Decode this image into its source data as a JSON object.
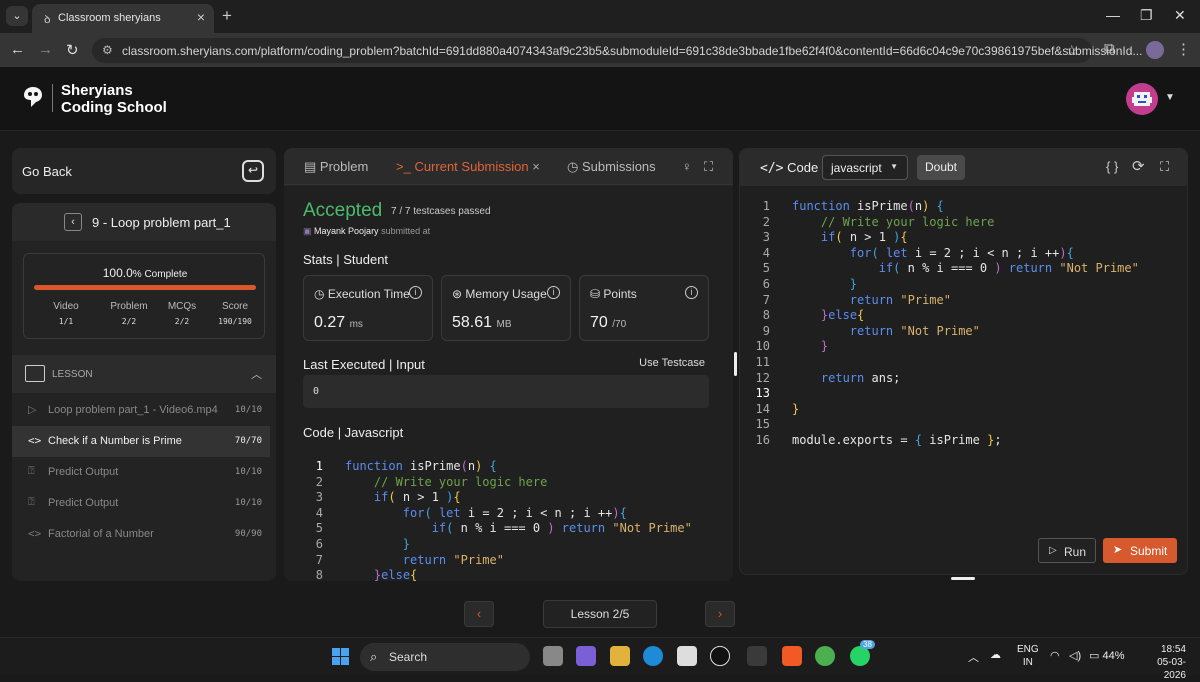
{
  "browser": {
    "tab_title": "Classroom sheryians",
    "url": "classroom.sheryians.com/platform/coding_problem?batchId=691dd880a4074343af9c23b5&submoduleId=691c38de3bbade1fbe62f4f0&contentId=66d6c04c9e70c39861975bef&submissionId..."
  },
  "brand": {
    "line1": "Sheryians",
    "line2": "Coding School"
  },
  "left": {
    "go_back": "Go Back",
    "module_title": "9 - Loop problem part_1",
    "progress": {
      "percent_value": "100.0",
      "percent_suffix": "% Complete",
      "fraction": 1.0,
      "stats": [
        {
          "label": "Video",
          "value": "1/1"
        },
        {
          "label": "Problem",
          "value": "2/2"
        },
        {
          "label": "MCQs",
          "value": "2/2"
        },
        {
          "label": "Score",
          "value": "190/190"
        }
      ]
    },
    "lesson_header": "LESSON",
    "lessons": [
      {
        "icon": "play-icon",
        "label": "Loop problem part_1 - Video6.mp4",
        "score": "10/10"
      },
      {
        "icon": "code-icon",
        "label": "Check if a Number is Prime",
        "score": "70/70"
      },
      {
        "icon": "question-icon",
        "label": "Predict Output",
        "score": "10/10"
      },
      {
        "icon": "question-icon",
        "label": "Predict Output",
        "score": "10/10"
      },
      {
        "icon": "code-icon",
        "label": "Factorial of a Number",
        "score": "90/90"
      }
    ]
  },
  "middle": {
    "tabs": {
      "problem": "Problem",
      "current": "Current Submission",
      "submissions": "Submissions"
    },
    "status": "Accepted",
    "testcases": "7 / 7 testcases passed",
    "submitter": "Mayank Poojary",
    "submitted_at": "submitted at",
    "stats_title": "Stats | Student",
    "stats": {
      "exec_label": "Execution Time",
      "exec_value": "0.27",
      "exec_unit": "ms",
      "mem_label": "Memory Usage",
      "mem_value": "58.61",
      "mem_unit": "MB",
      "points_label": "Points",
      "points_value": "70",
      "points_unit": "/70"
    },
    "last_executed_title": "Last Executed | Input",
    "use_testcase": "Use Testcase",
    "input_value": "0",
    "code_title": "Code | Javascript"
  },
  "editor": {
    "label": "Code",
    "language": "javascript",
    "doubt": "Doubt",
    "run": "Run",
    "submit": "Submit",
    "lines": [
      "function isPrime(n) {",
      "    // Write your logic here",
      "    if( n > 1 ){",
      "        for( let i = 2 ; i < n ; i ++){",
      "            if( n % i === 0 ) return \"Not Prime\"",
      "        }",
      "        return \"Prime\"",
      "    }else{",
      "        return \"Not Prime\"",
      "    }",
      "",
      "    return ans;",
      "",
      "}",
      "",
      "module.exports = { isPrime };"
    ]
  },
  "pager": {
    "label": "Lesson 2/5"
  },
  "taskbar": {
    "search": "Search",
    "lang_top": "ENG",
    "lang_bottom": "IN",
    "battery": "44%",
    "time": "18:54",
    "date": "05-03-2026",
    "badge": "38"
  }
}
